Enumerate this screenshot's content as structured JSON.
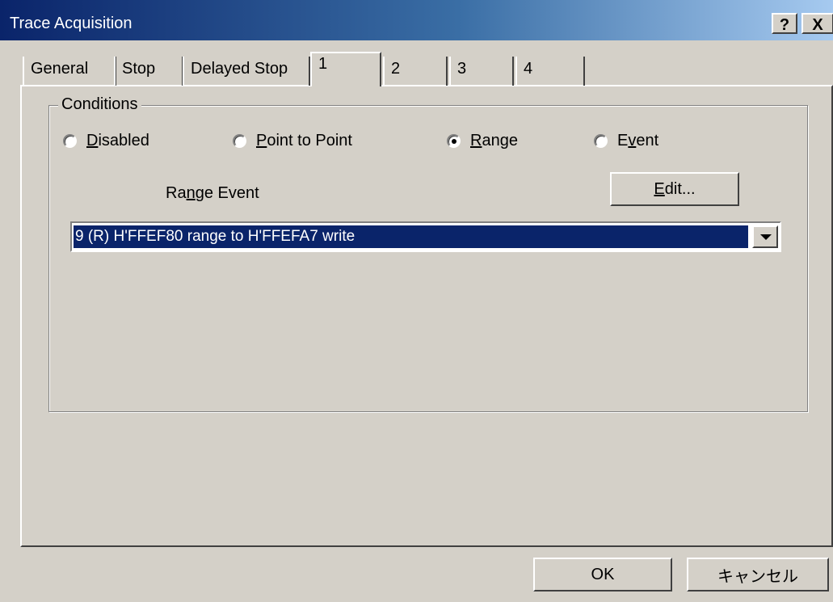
{
  "window": {
    "title": "Trace Acquisition",
    "help_button": "?",
    "close_button": "X"
  },
  "tabs": [
    {
      "label": "General"
    },
    {
      "label": "Stop"
    },
    {
      "label": "Delayed Stop"
    },
    {
      "label": "1"
    },
    {
      "label": "2"
    },
    {
      "label": "3"
    },
    {
      "label": "4"
    }
  ],
  "active_tab": "1",
  "conditions": {
    "group_label": "Conditions",
    "options": [
      {
        "pre": "",
        "key": "D",
        "post": "isabled",
        "selected": false
      },
      {
        "pre": "",
        "key": "P",
        "post": "oint to Point",
        "selected": false
      },
      {
        "pre": "",
        "key": "R",
        "post": "ange",
        "selected": true
      },
      {
        "pre": "E",
        "key": "v",
        "post": "ent",
        "selected": false
      }
    ]
  },
  "range_event": {
    "label_pre": "Ra",
    "label_key": "n",
    "label_post": "ge Event",
    "edit_key": "E",
    "edit_post": "dit...",
    "selected_value": "9 (R) H'FFEF80 range to H'FFEFA7 write"
  },
  "buttons": {
    "ok": "OK",
    "cancel": "キャンセル"
  },
  "colors": {
    "title_bar_start": "#0a246a",
    "title_bar_end": "#a6caf0",
    "selection": "#0a246a",
    "face": "#d4d0c8"
  }
}
